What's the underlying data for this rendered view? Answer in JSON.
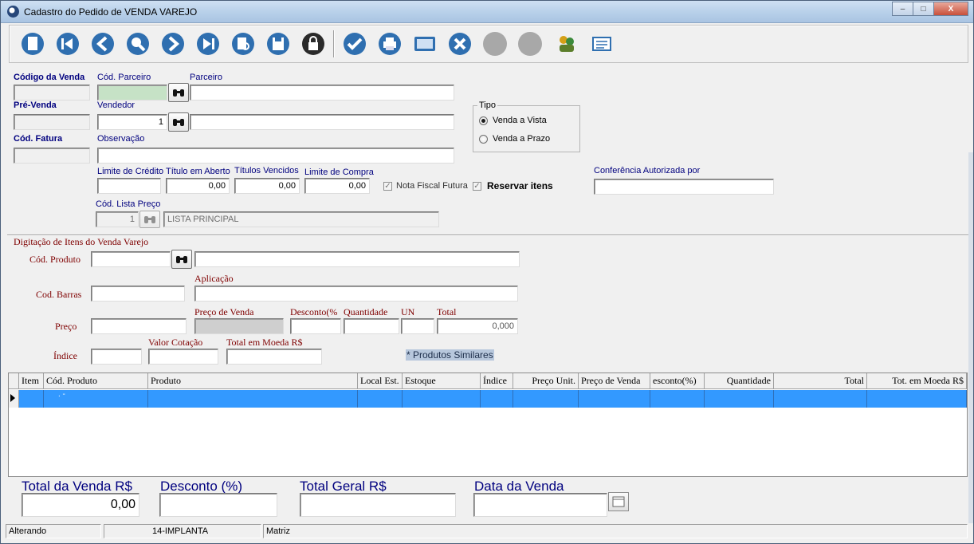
{
  "window": {
    "title": "Cadastro do Pedido de VENDA VAREJO",
    "min": "–",
    "max": "□",
    "close": "X"
  },
  "toolbar": {
    "icons": [
      "new-icon",
      "first-icon",
      "previous-icon",
      "search-icon",
      "next-icon",
      "last-icon",
      "find-icon",
      "save-icon",
      "lock-icon",
      "confirm-icon",
      "print-icon",
      "calculator-icon",
      "cancel-icon",
      "disabled-icon",
      "disabled-icon",
      "users-icon",
      "list-icon"
    ]
  },
  "header": {
    "codigo_venda_label": "Código da Venda",
    "pre_venda_label": "Pré-Venda",
    "cod_fatura_label": "Cód. Fatura",
    "cod_parceiro_label": "Cód. Parceiro",
    "parceiro_label": "Parceiro",
    "vendedor_label": "Vendedor",
    "vendedor_value": "1",
    "observacao_label": "Observação",
    "limite_credito_label": "Limite de Crédito",
    "titulo_aberto_label": "Título em Aberto",
    "titulo_aberto_value": "0,00",
    "titulos_vencidos_label": "Títulos Vencidos",
    "titulos_vencidos_value": "0,00",
    "limite_compra_label": "Limite de Compra",
    "limite_compra_value": "0,00",
    "nota_fiscal_label": "Nota Fiscal Futura",
    "reservar_label": "Reservar itens",
    "conferencia_label": "Conferência Autorizada por",
    "cod_lista_label": "Cód. Lista Preço",
    "cod_lista_value": "1",
    "lista_nome": "LISTA PRINCIPAL",
    "tipo_label": "Tipo",
    "venda_vista_label": "Venda a Vista",
    "venda_prazo_label": "Venda a Prazo"
  },
  "items": {
    "section_label": "Digitação de Itens do Venda Varejo",
    "cod_produto_label": "Cód. Produto",
    "cod_barras_label": "Cod. Barras",
    "aplicacao_label": "Aplicação",
    "preco_label": "Preço",
    "preco_venda_label": "Preço de Venda",
    "desconto_label": "Desconto(%",
    "quantidade_label": "Quantidade",
    "un_label": "UN",
    "total_label": "Total",
    "total_value": "0,000",
    "indice_label": "Índice",
    "valor_cotacao_label": "Valor Cotação",
    "total_moeda_label": "Total em Moeda R$",
    "similares_label": "* Produtos Similares"
  },
  "grid": {
    "columns": [
      "Item",
      "Cód. Produto",
      "Produto",
      "Local Est.",
      "Estoque",
      "Índice",
      "Preço Unit.",
      "Preço de Venda",
      "esconto(%)",
      "Quantidade",
      "Total",
      "Tot. em Moeda R$"
    ],
    "row_mark": ". -"
  },
  "totals": {
    "total_venda_label": "Total da Venda R$",
    "total_venda_value": "0,00",
    "desconto_label": "Desconto (%)",
    "total_geral_label": "Total Geral R$",
    "data_venda_label": "Data da Venda"
  },
  "status": {
    "mode": "Alterando",
    "company": "14-IMPLANTA",
    "branch": "Matriz"
  }
}
